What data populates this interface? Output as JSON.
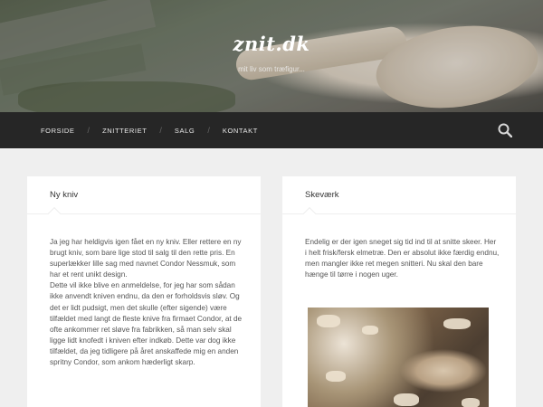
{
  "site": {
    "title": "znit.dk",
    "description": "mit liv som træfigur..."
  },
  "nav": {
    "items": [
      {
        "label": "FORSIDE"
      },
      {
        "label": "ZNITTERIET"
      },
      {
        "label": "SALG"
      },
      {
        "label": "KONTAKT"
      }
    ],
    "separator": "/",
    "search_icon": "search-icon"
  },
  "posts": [
    {
      "title": "Ny kniv",
      "body": "Ja jeg har heldigvis igen fået en ny kniv. Eller rettere en ny brugt kniv, som bare lige stod til salg til den rette pris. En superlækker lille sag med navnet Condor Nessmuk, som har et rent unikt design.\nDette vil ikke blive en anmeldelse, for jeg har som sådan ikke anvendt kniven endnu, da den er forholdsvis sløv. Og det er lidt pudsigt, men det skulle (efter sigende) være tilfældet med langt de fleste knive fra firmaet Condor, at de ofte ankommer ret sløve fra fabrikken, så man selv skal ligge lidt knofedt i kniven efter indkøb. Dette var dog ikke tilfældet, da jeg tidligere på året anskaffede mig en anden spritny Condor, som ankom hæderligt skarp."
    },
    {
      "title": "Skeværk",
      "body": "Endelig er der igen sneget sig tid ind til at snitte skeer. Her i helt frisk/fersk elmetræ. Den er absolut ikke færdig endnu, men mangler ikke ret megen snitteri. Nu skal den bare hænge til tørre i nogen uger."
    }
  ],
  "colors": {
    "nav_bg": "#262626",
    "page_bg": "#efefef",
    "card_bg": "#ffffff"
  }
}
